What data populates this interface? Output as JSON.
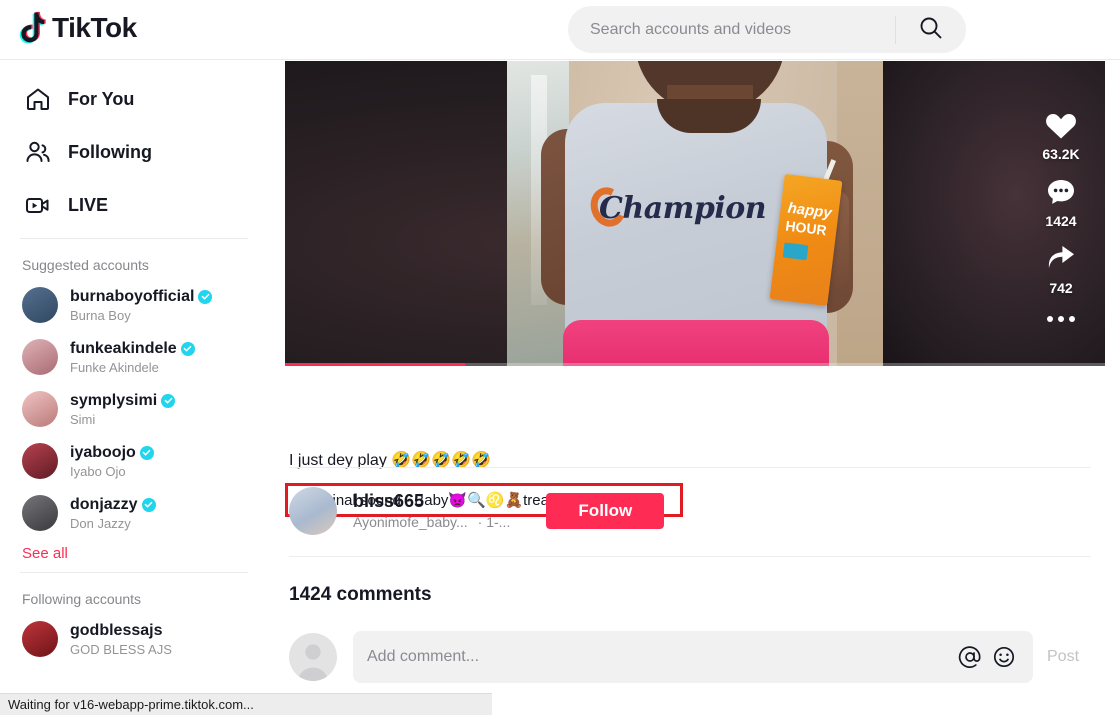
{
  "header": {
    "logo_text": "TikTok",
    "logo_icon": "tiktok-note-icon",
    "search": {
      "placeholder": "Search accounts and videos",
      "value": "",
      "icon": "search-icon"
    }
  },
  "sidebar": {
    "nav": [
      {
        "label": "For You",
        "icon": "home-icon"
      },
      {
        "label": "Following",
        "icon": "people-icon"
      },
      {
        "label": "LIVE",
        "icon": "live-video-icon"
      }
    ],
    "suggested_title": "Suggested accounts",
    "suggested": [
      {
        "username": "burnaboyofficial",
        "display": "Burna Boy",
        "verified": true,
        "avatar_color": "#3d5a80"
      },
      {
        "username": "funkeakindele",
        "display": "Funke Akindele",
        "verified": true,
        "avatar_color": "#c68a90"
      },
      {
        "username": "symplysimi",
        "display": "Simi",
        "verified": true,
        "avatar_color": "#d9a3a8"
      },
      {
        "username": "iyaboojo",
        "display": "Iyabo Ojo",
        "verified": true,
        "avatar_color": "#8e2b3a"
      },
      {
        "username": "donjazzy",
        "display": "Don Jazzy",
        "verified": true,
        "avatar_color": "#5a5a5c"
      }
    ],
    "see_all": "See all",
    "following_title": "Following accounts",
    "following": [
      {
        "username": "godblessajs",
        "display": "GOD BLESS AJS",
        "verified": false,
        "avatar_color": "#9e2a2b"
      }
    ]
  },
  "video": {
    "progress_percent": 22,
    "actions": [
      {
        "name": "like",
        "icon": "heart-icon",
        "count": "63.2K"
      },
      {
        "name": "comment",
        "icon": "comment-bubble-icon",
        "count": "1424"
      },
      {
        "name": "share",
        "icon": "share-arrow-icon",
        "count": "742"
      }
    ],
    "more_icon": "more-dots-icon",
    "shirt_text": "Champion",
    "juice_line1": "happy",
    "juice_line2": "HOUR"
  },
  "post": {
    "caption": "I just dey play 🤣🤣🤣🤣🤣",
    "sound_label": "original sound - Baby👿🔍♌🧸treasure",
    "music_icon": "music-note-icon",
    "author": {
      "username": "bliss665",
      "display_name": "Ayonimofe_baby...",
      "timestamp": "· 1-...",
      "follow_label": "Follow"
    }
  },
  "comments": {
    "count_label": "1424 comments",
    "input_placeholder": "Add comment...",
    "input_value": "",
    "mention_icon": "at-mention-icon",
    "emoji_icon": "emoji-smiley-icon",
    "post_label": "Post"
  },
  "status_bar": {
    "text": "Waiting for v16-webapp-prime.tiktok.com..."
  },
  "colors": {
    "brand_red": "#fe2c55",
    "verified_blue": "#20d5ec",
    "highlight_box": "#e01b24"
  }
}
